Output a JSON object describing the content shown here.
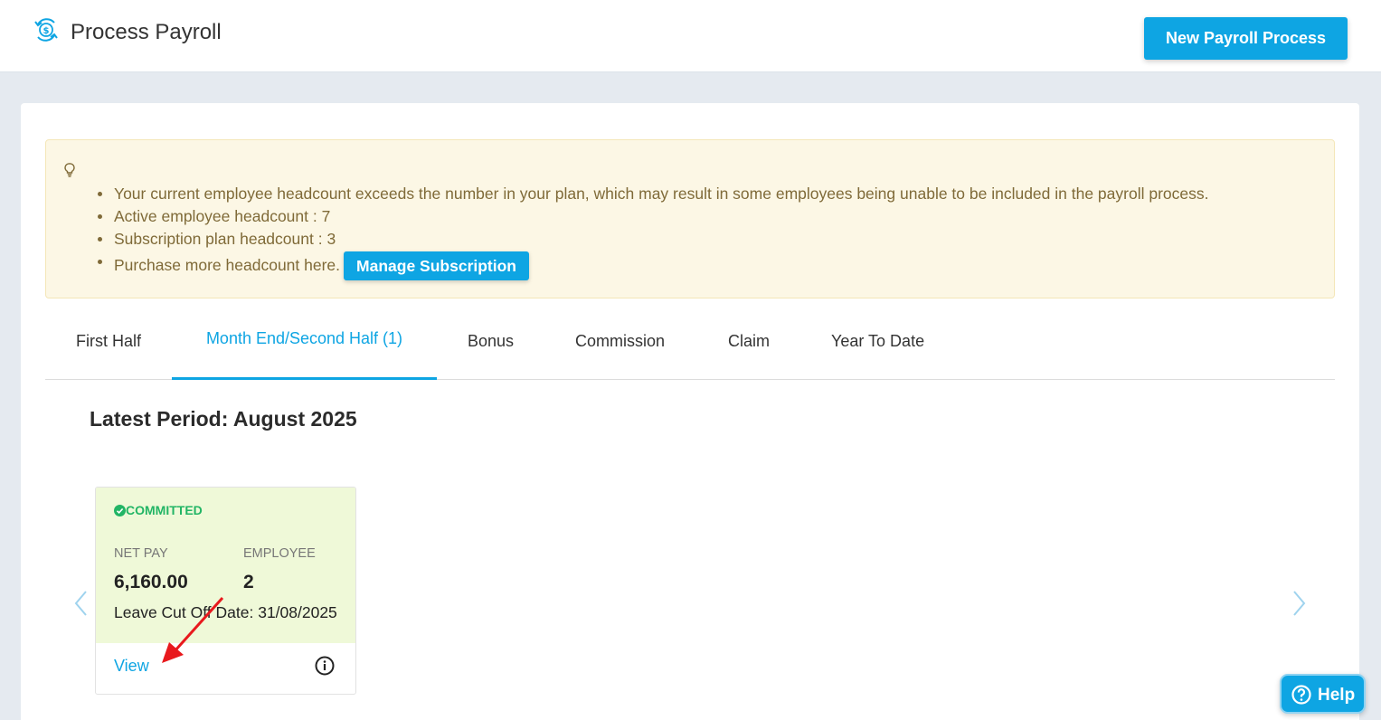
{
  "header": {
    "title": "Process Payroll",
    "icon": "payroll-cycle-icon",
    "new_button_label": "New Payroll Process"
  },
  "alert": {
    "icon": "lightbulb-icon",
    "items": [
      "Your current employee headcount exceeds the number in your plan, which may result in some employees being unable to be included in the payroll process.",
      "Active employee headcount : 7",
      "Subscription plan headcount : 3",
      "Purchase more headcount here."
    ],
    "manage_button_label": "Manage Subscription"
  },
  "tabs": [
    {
      "label": "First Half",
      "active": false
    },
    {
      "label": "Month End/Second Half (1)",
      "active": true
    },
    {
      "label": "Bonus",
      "active": false
    },
    {
      "label": "Commission",
      "active": false
    },
    {
      "label": "Claim",
      "active": false
    },
    {
      "label": "Year To Date",
      "active": false
    }
  ],
  "period": {
    "title": "Latest Period: August 2025"
  },
  "payroll_card": {
    "status": "COMMITTED",
    "net_pay_label": "NET PAY",
    "net_pay_value": "6,160.00",
    "employee_label": "EMPLOYEE",
    "employee_value": "2",
    "cutoff": "Leave Cut Off Date: 31/08/2025",
    "view_label": "View"
  },
  "help": {
    "label": "Help",
    "icon": "question-circle-icon"
  },
  "colors": {
    "accent": "#0ea5e3",
    "alert_bg": "#fcf7e5",
    "committed": "#22b565",
    "card_top": "#eff9d8",
    "annotation_arrow": "#e8191d"
  }
}
